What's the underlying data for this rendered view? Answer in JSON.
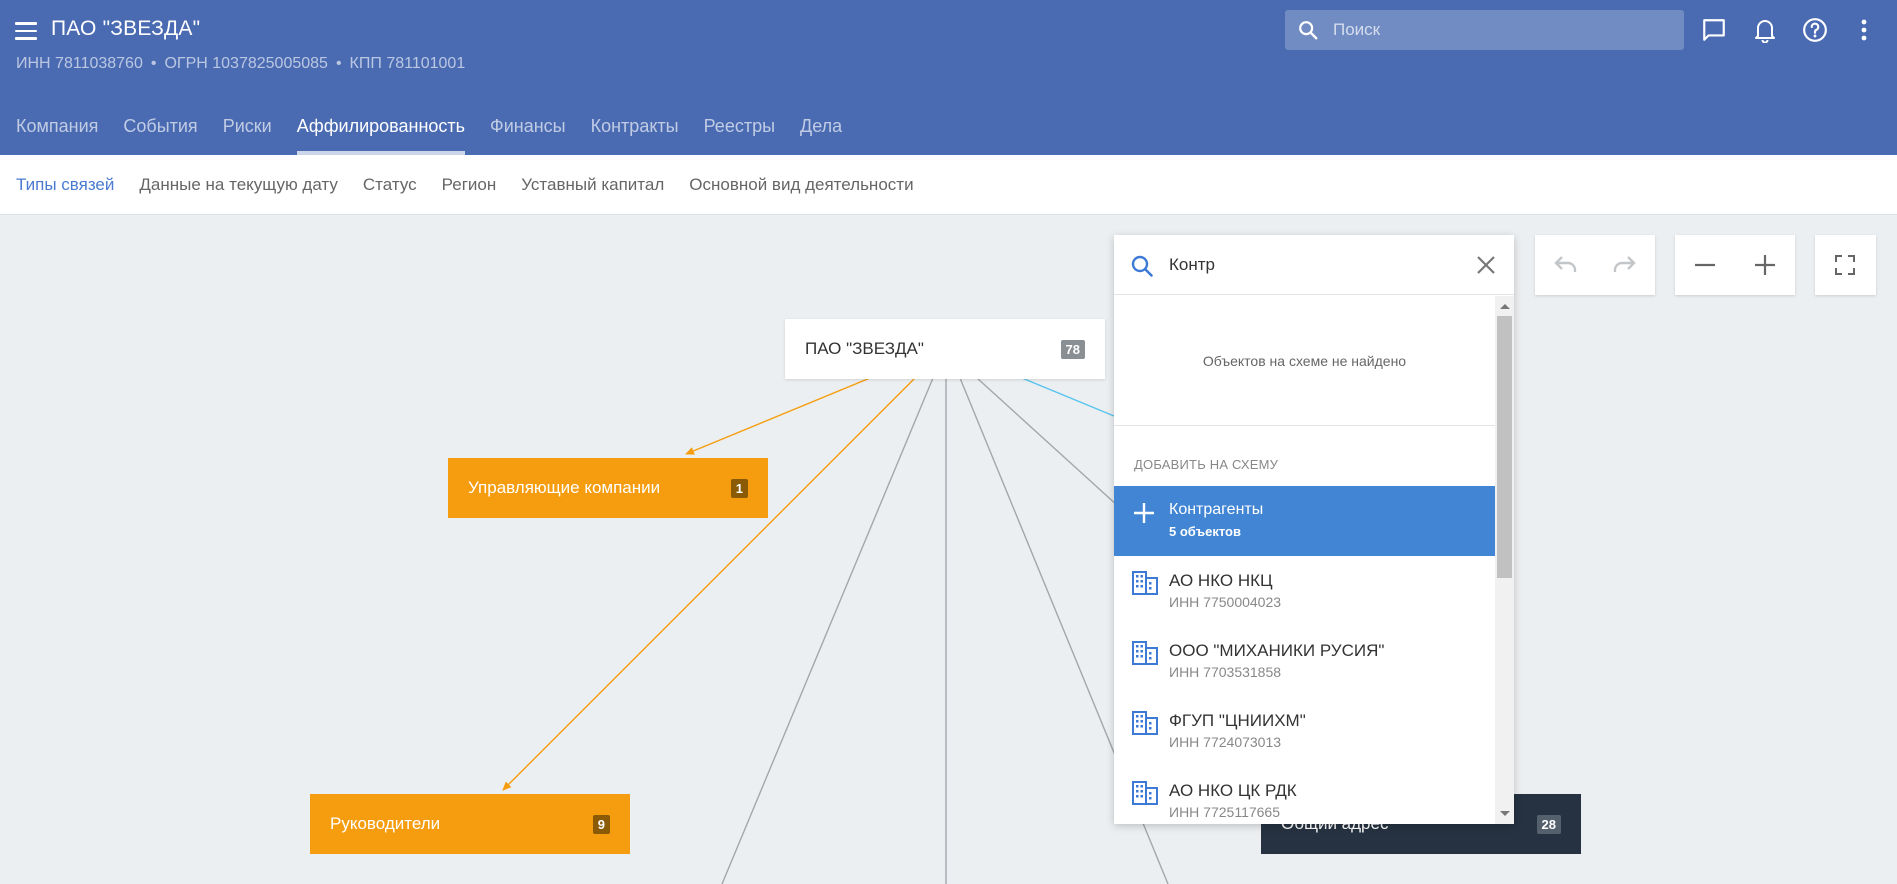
{
  "header": {
    "menu_icon": "hamburger-icon",
    "company_name": "ПАО \"ЗВЕЗДА\"",
    "inn": "ИНН 7811038760",
    "ogrn": "ОГРН 1037825005085",
    "kpp": "КПП 781101001",
    "separator": "•",
    "search_placeholder": "Поиск",
    "icons": [
      "chat-icon",
      "bell-icon",
      "help-icon",
      "more-vert-icon"
    ],
    "background_color": "#4a6bb2"
  },
  "tabs": [
    {
      "label": "Компания",
      "active": false
    },
    {
      "label": "События",
      "active": false
    },
    {
      "label": "Риски",
      "active": false
    },
    {
      "label": "Аффилированность",
      "active": true
    },
    {
      "label": "Финансы",
      "active": false
    },
    {
      "label": "Контракты",
      "active": false
    },
    {
      "label": "Реестры",
      "active": false
    },
    {
      "label": "Дела",
      "active": false
    }
  ],
  "subtabs": [
    {
      "label": "Типы связей",
      "active": true
    },
    {
      "label": "Данные на текущую дату",
      "active": false
    },
    {
      "label": "Статус",
      "active": false
    },
    {
      "label": "Регион",
      "active": false
    },
    {
      "label": "Уставный капитал",
      "active": false
    },
    {
      "label": "Основной вид деятельности",
      "active": false
    }
  ],
  "graph": {
    "root": {
      "label": "ПАО \"ЗВЕЗДА\"",
      "count": "78"
    },
    "nodes": [
      {
        "label": "Управляющие компании",
        "count": "1",
        "color": "#f59d0f"
      },
      {
        "label": "Руководители",
        "count": "9",
        "color": "#f59d0f"
      },
      {
        "label": "Общий адрес",
        "count": "28",
        "color": "#263241"
      }
    ]
  },
  "controls": {
    "undo_icon": "undo-icon",
    "redo_icon": "redo-icon",
    "zoom_out_icon": "minus-icon",
    "zoom_in_icon": "plus-icon",
    "fullscreen_icon": "fullscreen-icon"
  },
  "search_panel": {
    "query": "Контр",
    "not_found": "Объектов на схеме не найдено",
    "section_title": "ДОБАВИТЬ НА СХЕМУ",
    "add_item": {
      "title": "Контрагенты",
      "subtitle": "5 объектов",
      "icon": "plus-icon"
    },
    "results": [
      {
        "title": "АО НКО НКЦ",
        "subtitle": "ИНН 7750004023",
        "icon": "building-icon"
      },
      {
        "title": "ООО \"МИХАНИКИ РУСИЯ\"",
        "subtitle": "ИНН 7703531858",
        "icon": "building-icon"
      },
      {
        "title": "ФГУП \"ЦНИИХМ\"",
        "subtitle": "ИНН 7724073013",
        "icon": "building-icon"
      },
      {
        "title": "АО НКО ЦК РДК",
        "subtitle": "ИНН 7725117665",
        "icon": "building-icon"
      }
    ],
    "accent_color": "#4285d4"
  }
}
